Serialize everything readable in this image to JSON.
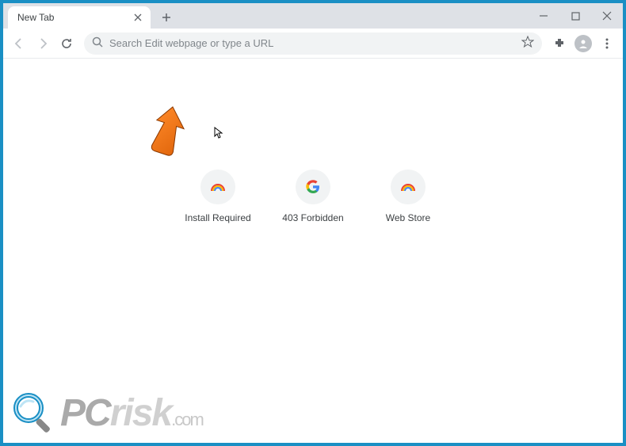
{
  "window": {
    "tab_title": "New Tab"
  },
  "toolbar": {
    "omnibox_placeholder": "Search Edit webpage or type a URL"
  },
  "content": {
    "shortcuts": [
      {
        "label": "Install Required",
        "icon": "rainbow"
      },
      {
        "label": "403 Forbidden",
        "icon": "google"
      },
      {
        "label": "Web Store",
        "icon": "rainbow"
      }
    ]
  },
  "watermark": {
    "text_pc": "PC",
    "text_risk": "risk",
    "text_domain": ".com"
  }
}
